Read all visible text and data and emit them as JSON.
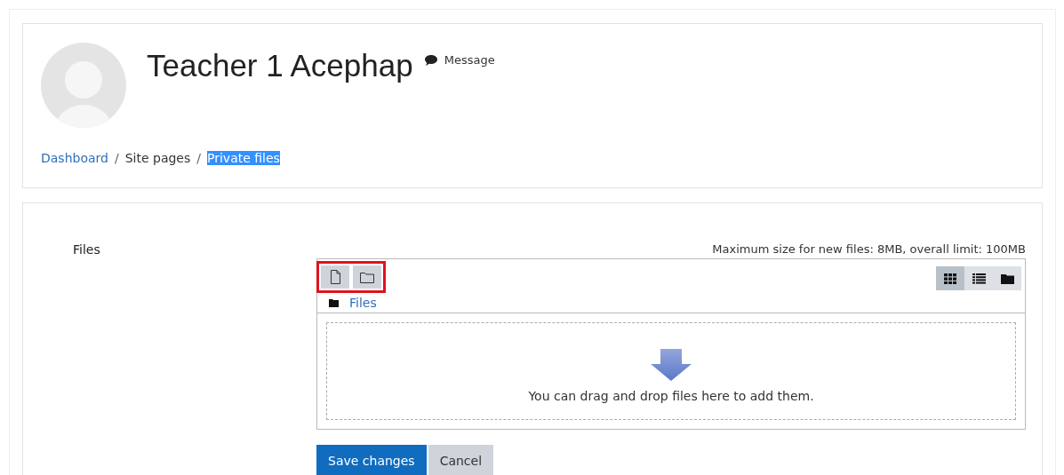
{
  "profile": {
    "name": "Teacher 1 Acephap",
    "message_link": "Message"
  },
  "breadcrumb_separator": "/",
  "breadcrumb": [
    {
      "label": "Dashboard",
      "kind": "link",
      "highlighted": false
    },
    {
      "label": "Site pages",
      "kind": "text",
      "highlighted": false
    },
    {
      "label": "Private files",
      "kind": "link",
      "highlighted": true
    }
  ],
  "form": {
    "label": "Files",
    "limits": "Maximum size for new files: 8MB, overall limit: 100MB",
    "file_buttons": {
      "highlighted": true,
      "items": [
        {
          "kind": "file"
        },
        {
          "kind": "folder"
        }
      ]
    },
    "view_buttons": [
      {
        "kind": "grid",
        "selected": true
      },
      {
        "kind": "list",
        "selected": false
      },
      {
        "kind": "tree",
        "selected": false
      }
    ],
    "path": "Files",
    "drop_hint": "You can drag and drop files here to add them."
  },
  "buttons": [
    {
      "label": "Save changes",
      "kind": "primary"
    },
    {
      "label": "Cancel",
      "kind": "secondary"
    }
  ]
}
